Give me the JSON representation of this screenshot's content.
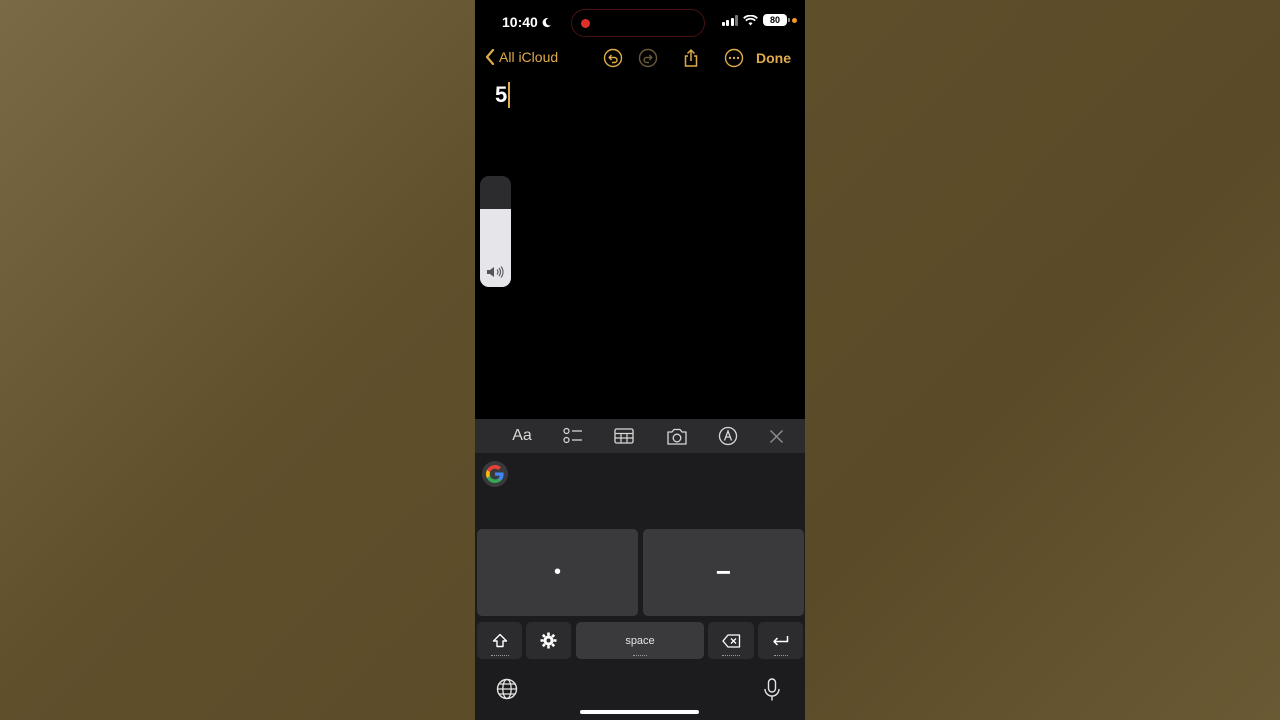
{
  "status_bar": {
    "time": "10:40",
    "battery": "80"
  },
  "nav": {
    "back_label": "All iCloud",
    "done_label": "Done"
  },
  "note": {
    "content": "5"
  },
  "volume": {
    "level": 0.7
  },
  "toolbar": {
    "format_label": "Aa"
  },
  "keyboard": {
    "dot_key": "•",
    "dash_key": "−",
    "space_label": "space"
  },
  "colors": {
    "accent": "#e0ac4b",
    "background": "#000000",
    "keyboard": "#1c1c1e"
  }
}
